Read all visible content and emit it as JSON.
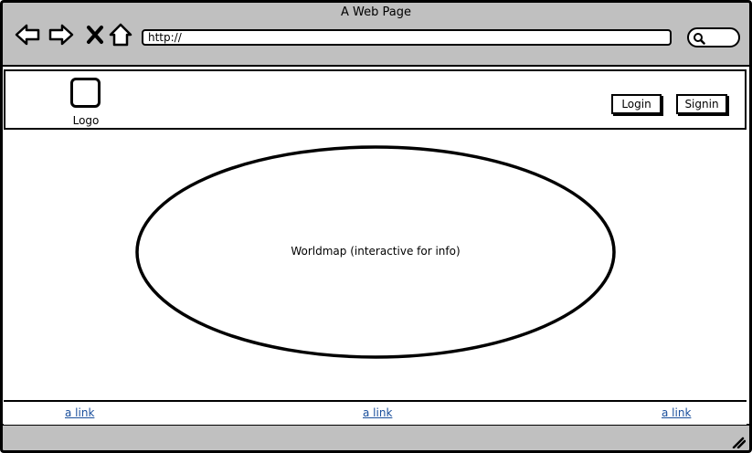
{
  "window": {
    "title": "A Web Page"
  },
  "toolbar": {
    "back_icon": "back-arrow-icon",
    "forward_icon": "forward-arrow-icon",
    "stop_icon": "close-icon",
    "home_icon": "home-icon",
    "address_value": "http://",
    "search_icon": "search-icon"
  },
  "header": {
    "logo_label": "Logo",
    "login_label": "Login",
    "signin_label": "Signin"
  },
  "main": {
    "map_label": "Worldmap (interactive for info)"
  },
  "footer": {
    "links": [
      "a link",
      "a link",
      "a link"
    ]
  },
  "colors": {
    "chrome": "#c0c0c0",
    "link": "#1a4f9c",
    "border": "#000000"
  }
}
